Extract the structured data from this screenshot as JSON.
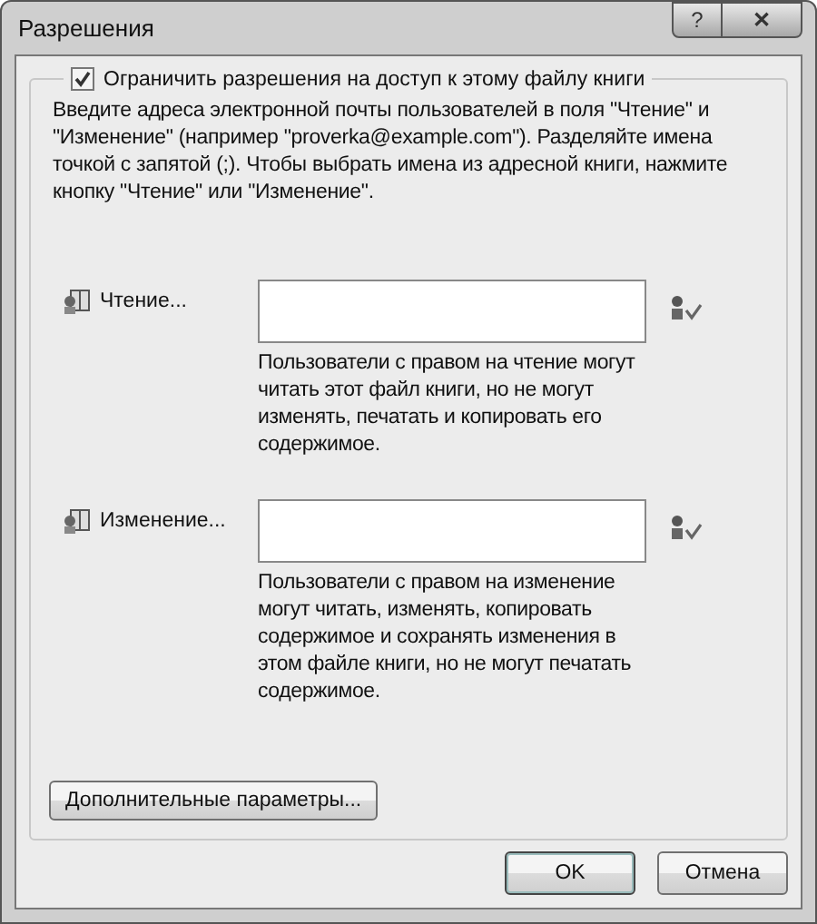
{
  "window": {
    "title": "Разрешения",
    "help": "?",
    "close": "✕"
  },
  "restrict": {
    "label": "Ограничить разрешения на доступ к этому файлу книги",
    "checked": true
  },
  "intro": "Введите адреса электронной почты пользователей в поля \"Чтение\" и \"Изменение\" (например \"proverka@example.com\"). Разделяйте имена точкой с запятой (;). Чтобы выбрать имена из адресной книги, нажмите кнопку \"Чтение\" или \"Изменение\".",
  "permissions": [
    {
      "label": "Чтение...",
      "description": "Пользователи с правом на чтение могут читать этот файл книги, но не могут изменять, печатать и копировать его содержимое."
    },
    {
      "label": "Изменение...",
      "description": "Пользователи с правом на изменение могут читать, изменять, копировать содержимое и сохранять изменения в этом файле книги, но не могут печатать содержимое."
    }
  ],
  "more_button": "Дополнительные параметры...",
  "buttons": [
    "OK",
    "Отмена"
  ]
}
